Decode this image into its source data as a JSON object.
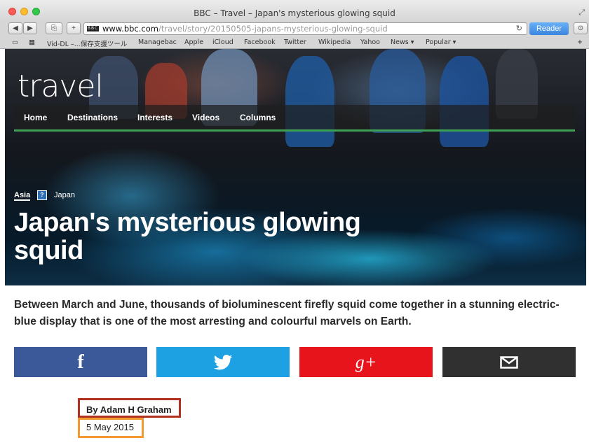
{
  "window": {
    "title": "BBC – Travel – Japan's mysterious glowing squid"
  },
  "toolbar": {
    "url_host": "www.bbc.com",
    "url_path": "/travel/story/20150505-japans-mysterious-glowing-squid",
    "reader_label": "Reader",
    "back_icon": "back-arrow-icon",
    "forward_icon": "forward-arrow-icon"
  },
  "bookmarks": [
    "Vid-DL –...保存支援ツール",
    "Managebac",
    "Apple",
    "iCloud",
    "Facebook",
    "Twitter",
    "Wikipedia",
    "Yahoo",
    "News ▾",
    "Popular ▾"
  ],
  "site": {
    "brand": "travel",
    "nav": [
      "Home",
      "Destinations",
      "Interests",
      "Videos",
      "Columns"
    ],
    "accent_color": "#3ea055"
  },
  "article": {
    "section": "Asia",
    "location": "Japan",
    "headline": "Japan's mysterious glowing squid",
    "lede": "Between March and June, thousands of bioluminescent firefly squid come together in a stunning electric-blue display that is one of the most arresting and colourful marvels on Earth.",
    "byline": "By Adam H Graham",
    "date": "5 May 2015"
  },
  "share": {
    "facebook_glyph": "f",
    "googleplus_glyph": "g+",
    "colors": {
      "facebook": "#3b5998",
      "twitter": "#1da1e2",
      "googleplus": "#e8141c",
      "email": "#303030"
    }
  },
  "annotations": {
    "byline_box_color": "#b1301f",
    "date_box_color": "#f19a2f"
  }
}
